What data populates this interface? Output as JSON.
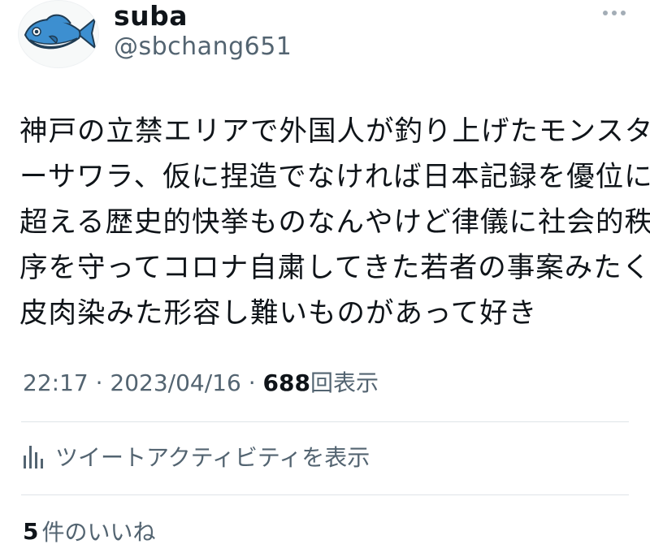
{
  "author": {
    "display_name": "suba",
    "handle": "@sbchang651",
    "avatar_icon": "fish-icon"
  },
  "tweet": {
    "lines": [
      "神戸の立禁エリアで外国人が釣り上げたモンスタ",
      "ーサワラ、仮に捏造でなければ日本記録を優位に",
      "超える歴史的快挙ものなんやけど律儀に社会的秩",
      "序を守ってコロナ自粛してきた若者の事案みたく",
      "皮肉染みた形容し難いものがあって好き"
    ]
  },
  "meta": {
    "time": "22:17",
    "separator": "·",
    "date": "2023/04/16",
    "views": "688",
    "views_label": "回表示"
  },
  "activity": {
    "icon": "analytics-icon",
    "label": "ツイートアクティビティを表示"
  },
  "likes": {
    "count": "5",
    "label": "件のいいね"
  },
  "colors": {
    "text": "#0f1419",
    "secondary": "#536471",
    "divider": "#dfe4e8",
    "fish": "#3d8fd0"
  }
}
